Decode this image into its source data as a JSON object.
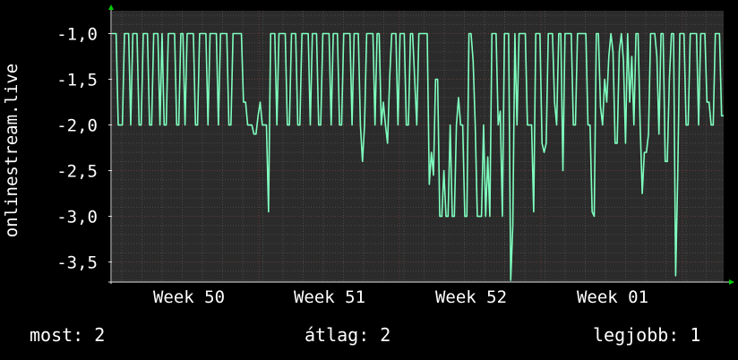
{
  "chart_data": {
    "type": "line",
    "ylabel": "onlinestream.live",
    "xlabel": "",
    "title": "",
    "ylim": [
      -3.72,
      -0.75
    ],
    "y_ticks": [
      -1.0,
      -1.5,
      -2.0,
      -2.5,
      -3.0,
      -3.5
    ],
    "y_tick_labels": [
      "-1,0",
      "-1,5",
      "-2,0",
      "-2,5",
      "-3,0",
      "-3,5"
    ],
    "x_tick_labels": [
      "Week 50",
      "Week 51",
      "Week 52",
      "Week 01"
    ],
    "grid": true,
    "colors": {
      "background": "#000000",
      "plot_background": "#2b2b2b",
      "grid_minor": "#4a4a4a",
      "grid_major": "#6a3a3a",
      "series_line": "#7fffbf",
      "axis": "#e0e0e0",
      "arrow": "#00cc00"
    },
    "series": [
      {
        "values": [
          -1,
          -1,
          -1,
          -2,
          -2,
          -2,
          -1,
          -1,
          -1,
          -2,
          -1,
          -1,
          -1,
          -2,
          -2,
          -1,
          -1,
          -1,
          -2,
          -2,
          -1,
          -1,
          -1,
          -2,
          -1,
          -2,
          -2,
          -1,
          -1,
          -1,
          -1,
          -2,
          -2,
          -1,
          -1,
          -2,
          -1,
          -1,
          -1,
          -1,
          -2,
          -2,
          -1,
          -1,
          -1,
          -1,
          -2,
          -1,
          -1,
          -1,
          -1,
          -2,
          -1,
          -1,
          -1,
          -1,
          -2,
          -2,
          -1,
          -1,
          -1,
          -1,
          -1,
          -1.75,
          -1.75,
          -2,
          -2,
          -2,
          -2.1,
          -2.1,
          -1.9,
          -1.75,
          -2,
          -2,
          -2,
          -2.95,
          -1,
          -1,
          -1,
          -2,
          -1,
          -1,
          -1,
          -1,
          -2,
          -2,
          -1,
          -1,
          -1,
          -2,
          -2,
          -1,
          -1,
          -1,
          -1,
          -2,
          -1,
          -1,
          -1,
          -2,
          -2,
          -1,
          -1,
          -1,
          -1,
          -2,
          -1,
          -1,
          -1,
          -2,
          -2,
          -1,
          -1,
          -1,
          -1,
          -2,
          -1,
          -1,
          -1,
          -2,
          -2.4,
          -2,
          -1,
          -1,
          -1,
          -1,
          -2,
          -1,
          -1,
          -2,
          -1.75,
          -2,
          -2.2,
          -1.5,
          -1,
          -1,
          -1,
          -2,
          -1,
          -1,
          -1,
          -2,
          -2,
          -1,
          -1,
          -1.5,
          -2,
          -1,
          -1,
          -1,
          -1,
          -1,
          -2.65,
          -2.3,
          -2.55,
          -1.5,
          -1.5,
          -3,
          -3,
          -2.5,
          -3,
          -3,
          -2,
          -3,
          -3,
          -2,
          -1.7,
          -2,
          -2,
          -3,
          -3,
          -1,
          -1,
          -1.3,
          -2,
          -3,
          -3,
          -3,
          -2,
          -3,
          -2.35,
          -3,
          -1,
          -1,
          -1,
          -2,
          -1.85,
          -3,
          -1,
          -1,
          -1,
          -3.7,
          -3.1,
          -1,
          -2,
          -1,
          -1,
          -1,
          -1,
          -2,
          -2,
          -2,
          -2.95,
          -1,
          -1,
          -1,
          -2.2,
          -2.3,
          -2.2,
          -1,
          -1,
          -1,
          -1.75,
          -2,
          -1,
          -1,
          -2.5,
          -1,
          -1,
          -1,
          -1,
          -2,
          -2,
          -1,
          -1,
          -1,
          -1,
          -1,
          -2,
          -2,
          -2.95,
          -3,
          -1,
          -1,
          -1.8,
          -2,
          -1.5,
          -1.75,
          -1.25,
          -1,
          -1.2,
          -2.2,
          -2.2,
          -1.2,
          -1,
          -1.3,
          -2.2,
          -1,
          -1.75,
          -1.25,
          -2,
          -1,
          -1,
          -2,
          -2.75,
          -2.3,
          -2.3,
          -2.1,
          -1,
          -1,
          -1,
          -1.25,
          -2.1,
          -1,
          -1,
          -2.4,
          -2.4,
          -1.5,
          -1,
          -1,
          -3.65,
          -2.55,
          -1,
          -1,
          -1,
          -2,
          -2,
          -1,
          -1,
          -1,
          -1,
          -2,
          -1,
          -1,
          -1,
          -1.75,
          -1.75,
          -2,
          -2,
          -1,
          -1,
          -1,
          -1.9,
          -1.9
        ]
      }
    ]
  },
  "footer": {
    "current": "most: 2",
    "average": "átlag: 2",
    "best": "legjobb: 1"
  }
}
